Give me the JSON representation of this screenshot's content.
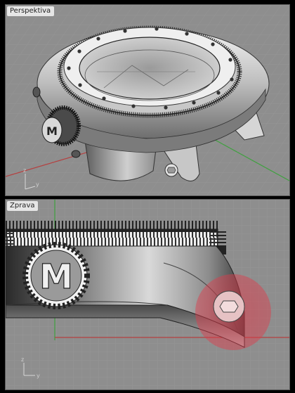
{
  "viewports": [
    {
      "id": "perspective",
      "label": "Perspektiva",
      "axes": {
        "vertical": "z",
        "horizontal": "y"
      }
    },
    {
      "id": "right",
      "label": "Zprava",
      "axes": {
        "vertical": "z",
        "horizontal": "y"
      }
    }
  ],
  "colors": {
    "background": "#8e8e8e",
    "grid": "#9d9d9d",
    "axis_red": "#b54040",
    "axis_green": "#3fa13f",
    "highlight": "#e03a4a",
    "label_bg": "#e6e6e6"
  },
  "model": {
    "crown_letter": "M"
  }
}
